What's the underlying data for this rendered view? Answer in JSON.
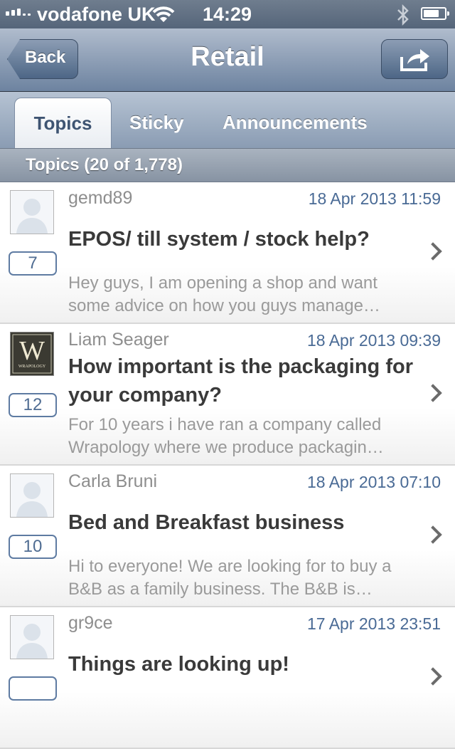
{
  "status_bar": {
    "carrier": "vodafone UK",
    "time": "14:29",
    "battery_level": 0.75
  },
  "nav": {
    "back_label": "Back",
    "title": "Retail",
    "share_icon": "share-icon"
  },
  "tabs": [
    {
      "label": "Topics",
      "active": true
    },
    {
      "label": "Sticky",
      "active": false
    },
    {
      "label": "Announcements",
      "active": false
    }
  ],
  "section_header": "Topics (20 of 1,778)",
  "topics": [
    {
      "author": "gemd89",
      "date": "18 Apr 2013 11:59",
      "title": "EPOS/ till system / stock help?",
      "excerpt": "Hey guys, I am opening a shop and want some advice on how you guys manage…",
      "replies": "7",
      "avatar": "default-avatar-icon"
    },
    {
      "author": "Liam Seager",
      "date": "18 Apr 2013 09:39",
      "title": "How important is the packaging for your company?",
      "excerpt": "For 10 years i have ran a company called Wrapology where we produce packagin…",
      "replies": "12",
      "avatar": "wrapology-logo",
      "avatar_text": "WRAPOLOGY"
    },
    {
      "author": "Carla Bruni",
      "date": "18 Apr 2013 07:10",
      "title": "Bed and Breakfast business",
      "excerpt": "Hi to everyone! We are looking for to buy a B&B as a family business. The B&B is…",
      "replies": "10",
      "avatar": "default-avatar-icon"
    },
    {
      "author": "gr9ce",
      "date": "17 Apr 2013 23:51",
      "title": "Things are looking up!",
      "excerpt": "",
      "replies": "",
      "avatar": "default-avatar-icon"
    }
  ],
  "colors": {
    "nav_bar": "#8e9fb6",
    "accent": "#496a95",
    "status_bar": "#5f6e82"
  }
}
